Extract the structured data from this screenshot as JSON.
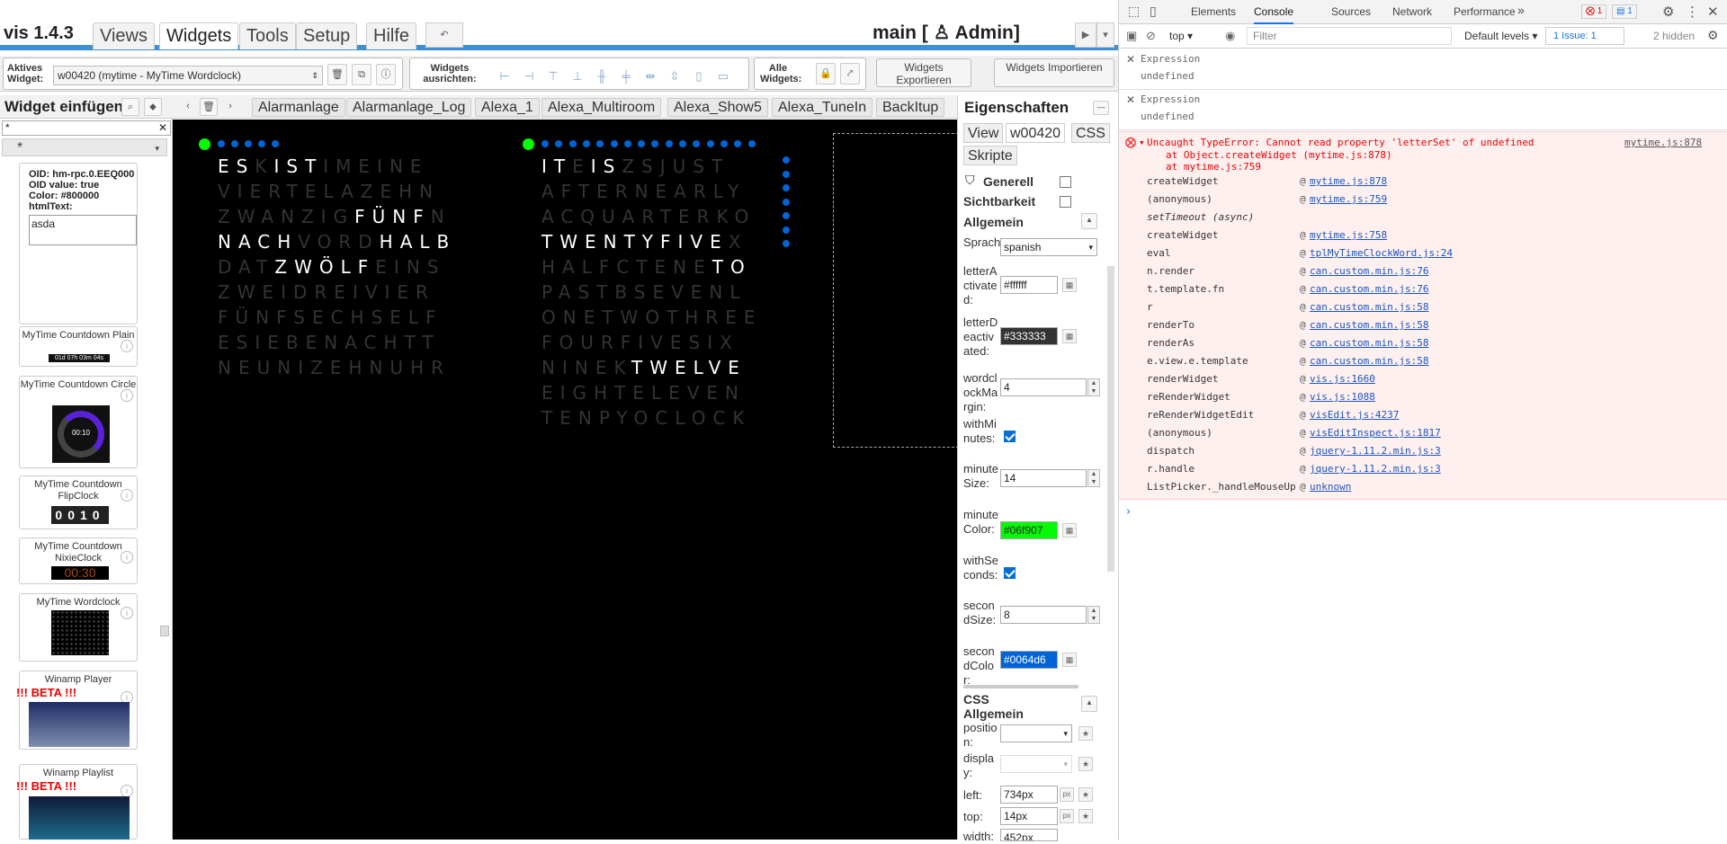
{
  "app": {
    "version": "vis 1.4.3",
    "main_label": "main [ ♙ Admin]"
  },
  "menu": [
    "Views",
    "Widgets",
    "Tools",
    "Setup",
    "Hilfe"
  ],
  "toolbar": {
    "active_widget_label": "Aktives Widget:",
    "active_widget_value": "w00420 (mytime - MyTime Wordclock)",
    "align_label": "Widgets ausrichten:",
    "all_label": "Alle Widgets:",
    "export_label": "Widgets Exportieren",
    "import_label": "Widgets Importieren"
  },
  "left_panel": {
    "title": "Widget einfügen",
    "filter_value": "*",
    "group_value": "*",
    "preview": {
      "oid": "OID: hm-rpc.0.EEQ000",
      "oid_value": "OID value: true",
      "color": "Color: #800000",
      "html_label": "htmlText:",
      "html_value": "asda"
    },
    "widgets": [
      {
        "name": "MyTime Countdown Plain",
        "preview": "01d 07h 03m 04s"
      },
      {
        "name": "MyTime Countdown Circle",
        "preview": "00:10"
      },
      {
        "name": "MyTime Countdown FlipClock",
        "preview": "0010"
      },
      {
        "name": "MyTime Countdown NixieClock",
        "preview": "00:30"
      },
      {
        "name": "MyTime Wordclock",
        "preview": ""
      },
      {
        "name": "Winamp Player",
        "badge": "!!! BETA !!!"
      },
      {
        "name": "Winamp Playlist",
        "badge": "!!! BETA !!!"
      }
    ]
  },
  "view_tabs": [
    "Alarmanlage",
    "Alarmanlage_Log",
    "Alexa_1",
    "Alexa_Multiroom",
    "Alexa_Show5",
    "Alexa_TuneIn",
    "BackItup"
  ],
  "wordclock_de": {
    "rows": [
      [
        [
          "ES",
          "on"
        ],
        [
          "K",
          "off"
        ],
        [
          "IST",
          "on"
        ],
        [
          "IMEINE",
          "off"
        ]
      ],
      [
        [
          "VIERTELAZEHN",
          "off"
        ]
      ],
      [
        [
          "ZWANZIG",
          "off"
        ],
        [
          "FÜNF",
          "on"
        ],
        [
          "N",
          "off"
        ]
      ],
      [
        [
          "NACH",
          "on"
        ],
        [
          "VORD",
          "off"
        ],
        [
          "HALB",
          "on"
        ]
      ],
      [
        [
          "DAT",
          "off"
        ],
        [
          "ZWÖLF",
          "on"
        ],
        [
          "EINS",
          "off"
        ]
      ],
      [
        [
          "ZWEIDREIVIER",
          "off"
        ]
      ],
      [
        [
          "FÜNFSECHSELF",
          "off"
        ]
      ],
      [
        [
          "ESIEBENACHTT",
          "off"
        ]
      ],
      [
        [
          "NEUNIZEHNUHR",
          "off"
        ]
      ]
    ]
  },
  "wordclock_en": {
    "rows": [
      [
        [
          "IT",
          "on"
        ],
        [
          "E",
          "off"
        ],
        [
          "IS",
          "on"
        ],
        [
          "ZSJUST",
          "off"
        ]
      ],
      [
        [
          "AFTERNEARLY",
          "off"
        ]
      ],
      [
        [
          "ACQUARTERKO",
          "off"
        ]
      ],
      [
        [
          "TWENTYFIVE",
          "on"
        ],
        [
          "X",
          "off"
        ]
      ],
      [
        [
          "HALFCTENE",
          "off"
        ],
        [
          "TO",
          "on"
        ]
      ],
      [
        [
          "PASTBSEVENL",
          "off"
        ]
      ],
      [
        [
          "ONETWOTHREE",
          "off"
        ]
      ],
      [
        [
          "FOURFIVESIX",
          "off"
        ]
      ],
      [
        [
          "NINEK",
          "off"
        ],
        [
          "TWELVE",
          "on"
        ]
      ],
      [
        [
          "EIGHTELEVEN",
          "off"
        ]
      ],
      [
        [
          "TENPYOCLOCK",
          "off"
        ]
      ]
    ]
  },
  "properties": {
    "title": "Eigenschaften",
    "tabs": [
      "View",
      "w00420",
      "CSS",
      "Skripte"
    ],
    "generell": "Generell",
    "sichtbarkeit": "Sichtbarkeit",
    "allgemein": "Allgemein",
    "fields": [
      {
        "label": "Sprache:",
        "value": "spanish"
      },
      {
        "label": "letterActivated:",
        "value": "#ffffff"
      },
      {
        "label": "letterDeactivated:",
        "value": "#333333"
      },
      {
        "label": "wordclockMargin:",
        "value": "4"
      },
      {
        "label": "withMinutes:",
        "value": "true"
      },
      {
        "label": "minuteSize:",
        "value": "14"
      },
      {
        "label": "minuteColor:",
        "value": "#06f907"
      },
      {
        "label": "withSeconds:",
        "value": "true"
      },
      {
        "label": "secondSize:",
        "value": "8"
      },
      {
        "label": "secondColor:",
        "value": "#0064d6"
      }
    ],
    "css_section": "CSS Allgemein",
    "css_fields": [
      {
        "label": "position:",
        "value": ""
      },
      {
        "label": "display:",
        "value": ""
      },
      {
        "label": "left:",
        "value": "734px"
      },
      {
        "label": "top:",
        "value": "14px"
      },
      {
        "label": "width:",
        "value": "452px"
      }
    ],
    "unit": "px"
  },
  "devtools": {
    "tabs": [
      "Elements",
      "Console",
      "Sources",
      "Network",
      "Performance"
    ],
    "more": "»",
    "errors": "1",
    "messages": "1",
    "context": "top",
    "filter_placeholder": "Filter",
    "levels": "Default levels ▾",
    "issues": "1 Issue: 1",
    "hidden": "2 hidden",
    "expressions": [
      {
        "label": "Expression",
        "value": "undefined"
      },
      {
        "label": "Expression",
        "value": "undefined"
      }
    ],
    "error": {
      "message": "Uncaught TypeError: Cannot read property 'letterSet' of undefined",
      "source": "mytime.js:878",
      "at1": "at Object.createWidget (mytime.js:878)",
      "at2": "at mytime.js:759"
    },
    "stack": [
      {
        "fn": "createWidget",
        "loc": "mytime.js:878"
      },
      {
        "fn": "(anonymous)",
        "loc": "mytime.js:759"
      },
      {
        "fn": "setTimeout (async)",
        "loc": ""
      },
      {
        "fn": "createWidget",
        "loc": "mytime.js:758"
      },
      {
        "fn": "eval",
        "loc": "tplMyTimeClockWord.js:24"
      },
      {
        "fn": "n.render",
        "loc": "can.custom.min.js:76"
      },
      {
        "fn": "t.template.fn",
        "loc": "can.custom.min.js:76"
      },
      {
        "fn": "r",
        "loc": "can.custom.min.js:58"
      },
      {
        "fn": "renderTo",
        "loc": "can.custom.min.js:58"
      },
      {
        "fn": "renderAs",
        "loc": "can.custom.min.js:58"
      },
      {
        "fn": "e.view.e.template",
        "loc": "can.custom.min.js:58"
      },
      {
        "fn": "renderWidget",
        "loc": "vis.js:1660"
      },
      {
        "fn": "reRenderWidget",
        "loc": "vis.js:1088"
      },
      {
        "fn": "reRenderWidgetEdit",
        "loc": "visEdit.js:4237"
      },
      {
        "fn": "(anonymous)",
        "loc": "visEditInspect.js:1817"
      },
      {
        "fn": "dispatch",
        "loc": "jquery-1.11.2.min.js:3"
      },
      {
        "fn": "r.handle",
        "loc": "jquery-1.11.2.min.js:3"
      },
      {
        "fn": "ListPicker._handleMouseUp",
        "loc": "unknown"
      }
    ],
    "prompt": "›"
  },
  "colors": {
    "accent": "#3d8fd6",
    "active": "#ffffff",
    "inactive": "#333333",
    "minute": "#06f907",
    "second": "#0064d6",
    "error": "#e00"
  }
}
